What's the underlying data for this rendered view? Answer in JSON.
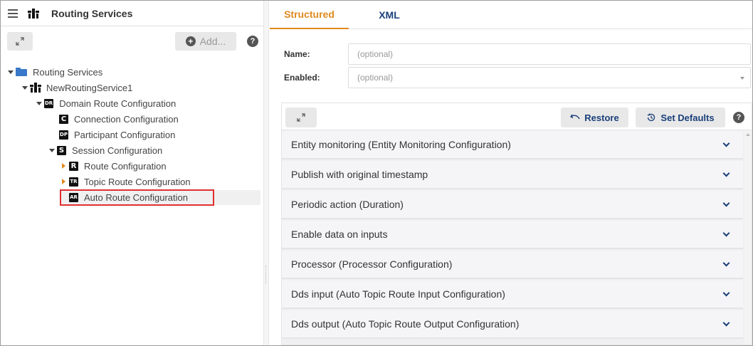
{
  "app": {
    "title": "Routing Services"
  },
  "left_toolbar": {
    "add_label": "Add...",
    "help": "?"
  },
  "tree": [
    {
      "label": "Routing Services",
      "icon": "folder-icon"
    },
    {
      "label": "NewRoutingService1",
      "icon": "routing-service-icon"
    },
    {
      "label": "Domain Route Configuration",
      "badge": "DR"
    },
    {
      "label": "Connection Configuration",
      "badge": "C"
    },
    {
      "label": "Participant Configuration",
      "badge": "DP"
    },
    {
      "label": "Session Configuration",
      "badge": "S"
    },
    {
      "label": "Route Configuration",
      "badge": "R"
    },
    {
      "label": "Topic Route Configuration",
      "badge": "TR"
    },
    {
      "label": "Auto Route Configuration",
      "badge": "AR",
      "selected": true
    }
  ],
  "tabs": [
    {
      "label": "Structured",
      "active": true
    },
    {
      "label": "XML",
      "active": false
    }
  ],
  "form": {
    "name_label": "Name:",
    "name_placeholder": "(optional)",
    "enabled_label": "Enabled:",
    "enabled_placeholder": "(optional)"
  },
  "config_toolbar": {
    "restore_label": "Restore",
    "defaults_label": "Set Defaults",
    "help": "?"
  },
  "sections": [
    "Entity monitoring (Entity Monitoring Configuration)",
    "Publish with original timestamp",
    "Periodic action (Duration)",
    "Enable data on inputs",
    "Processor (Processor Configuration)",
    "Dds input (Auto Topic Route Input Configuration)",
    "Dds output (Auto Topic Route Output Configuration)"
  ],
  "colors": {
    "accent": "#e08a1e",
    "link": "#1a3f7a",
    "highlight": "#e03030"
  }
}
